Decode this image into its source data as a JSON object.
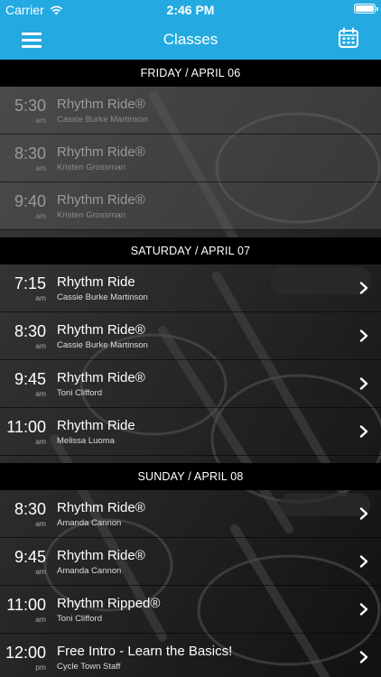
{
  "status": {
    "carrier": "Carrier",
    "time": "2:46 PM"
  },
  "nav": {
    "title": "Classes"
  },
  "days": [
    {
      "label": "FRIDAY / APRIL 06",
      "classes": [
        {
          "time": "5:30",
          "ampm": "am",
          "title": "Rhythm Ride®",
          "instructor": "Cassie Burke Martinson",
          "past": true
        },
        {
          "time": "8:30",
          "ampm": "am",
          "title": "Rhythm Ride®",
          "instructor": "Kristen Grossman",
          "past": true
        },
        {
          "time": "9:40",
          "ampm": "am",
          "title": "Rhythm Ride®",
          "instructor": "Kristen Grossman",
          "past": true
        }
      ]
    },
    {
      "label": "SATURDAY / APRIL 07",
      "classes": [
        {
          "time": "7:15",
          "ampm": "am",
          "title": "Rhythm Ride",
          "instructor": "Cassie Burke Martinson",
          "past": false
        },
        {
          "time": "8:30",
          "ampm": "am",
          "title": "Rhythm Ride®",
          "instructor": "Cassie Burke Martinson",
          "past": false
        },
        {
          "time": "9:45",
          "ampm": "am",
          "title": "Rhythm Ride®",
          "instructor": "Toni Clifford",
          "past": false
        },
        {
          "time": "11:00",
          "ampm": "am",
          "title": "Rhythm Ride",
          "instructor": "Melissa Luoma",
          "past": false
        }
      ]
    },
    {
      "label": "SUNDAY / APRIL 08",
      "classes": [
        {
          "time": "8:30",
          "ampm": "am",
          "title": "Rhythm Ride®",
          "instructor": "Amanda Cannon",
          "past": false
        },
        {
          "time": "9:45",
          "ampm": "am",
          "title": "Rhythm Ride®",
          "instructor": "Amanda Cannon",
          "past": false
        },
        {
          "time": "11:00",
          "ampm": "am",
          "title": "Rhythm Ripped®",
          "instructor": "Toni Clifford",
          "past": false
        },
        {
          "time": "12:00",
          "ampm": "pm",
          "title": "Free Intro - Learn the Basics!",
          "instructor": "Cycle Town Staff",
          "past": false
        }
      ]
    }
  ],
  "colors": {
    "header": "#24aae1",
    "day_header": "#000000"
  },
  "icons": {
    "menu": "hamburger-menu-icon",
    "calendar": "calendar-icon",
    "chevron": "chevron-right-icon",
    "wifi": "wifi-icon",
    "battery": "battery-icon"
  }
}
